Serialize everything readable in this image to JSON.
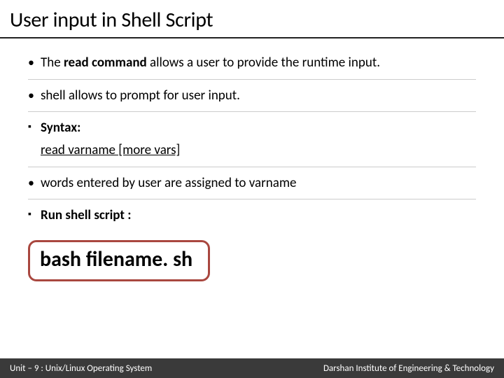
{
  "title": "User input in Shell Script",
  "bullets": {
    "b1_pre": "The ",
    "b1_bold": "read command",
    "b1_post": " allows a user to provide the runtime input.",
    "b2": "shell allows to prompt for user input.",
    "b3": "Syntax:",
    "syntax": " read varname [more vars]",
    "b4": "words entered by user are assigned to varname",
    "b5": "Run shell script :"
  },
  "highlight": "bash filename. sh",
  "footer": {
    "left": "Unit – 9  : Unix/Linux Operating System",
    "right": "Darshan Institute of Engineering & Technology"
  }
}
